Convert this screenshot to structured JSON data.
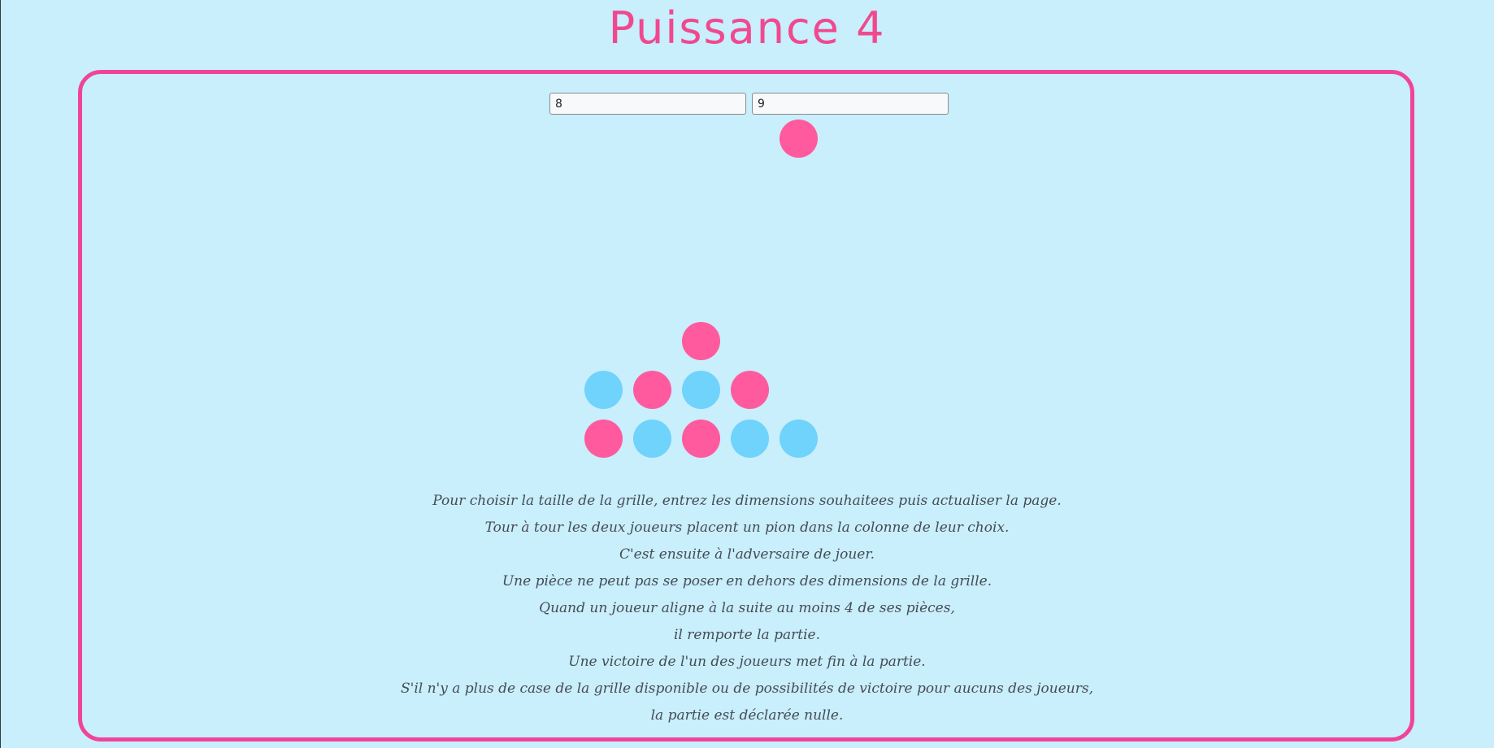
{
  "title": "Puissance 4",
  "inputs": {
    "rows_value": "8",
    "cols_value": "9"
  },
  "board": {
    "rows": 8,
    "columns": 9,
    "player_colors": {
      "pink": "#ff5a9e",
      "blue": "#6fd3fb"
    },
    "frame_color": "#f0449b",
    "background_color": "#c9eefc",
    "hover_disc": {
      "column": 6,
      "color": "pink"
    },
    "cells": [
      {
        "row": 6,
        "col": 4,
        "color": "pink"
      },
      {
        "row": 7,
        "col": 2,
        "color": "blue"
      },
      {
        "row": 7,
        "col": 3,
        "color": "pink"
      },
      {
        "row": 7,
        "col": 4,
        "color": "blue"
      },
      {
        "row": 7,
        "col": 5,
        "color": "pink"
      },
      {
        "row": 8,
        "col": 2,
        "color": "pink"
      },
      {
        "row": 8,
        "col": 3,
        "color": "blue"
      },
      {
        "row": 8,
        "col": 4,
        "color": "pink"
      },
      {
        "row": 8,
        "col": 5,
        "color": "blue"
      },
      {
        "row": 8,
        "col": 6,
        "color": "blue"
      }
    ]
  },
  "rules": [
    "Pour choisir la taille de la grille, entrez les dimensions souhaitees puis actualiser la page.",
    "Tour à tour les deux joueurs placent un pion dans la colonne de leur choix.",
    "C'est ensuite à l'adversaire de jouer.",
    "Une pièce ne peut pas se poser en dehors des dimensions de la grille.",
    "Quand un joueur aligne à la suite au moins 4 de ses pièces,",
    "il remporte la partie.",
    "Une victoire de l'un des joueurs met fin à la partie.",
    "S'il n'y a plus de case de la grille disponible ou de possibilités de victoire pour aucuns des joueurs,",
    "la partie est déclarée nulle."
  ]
}
